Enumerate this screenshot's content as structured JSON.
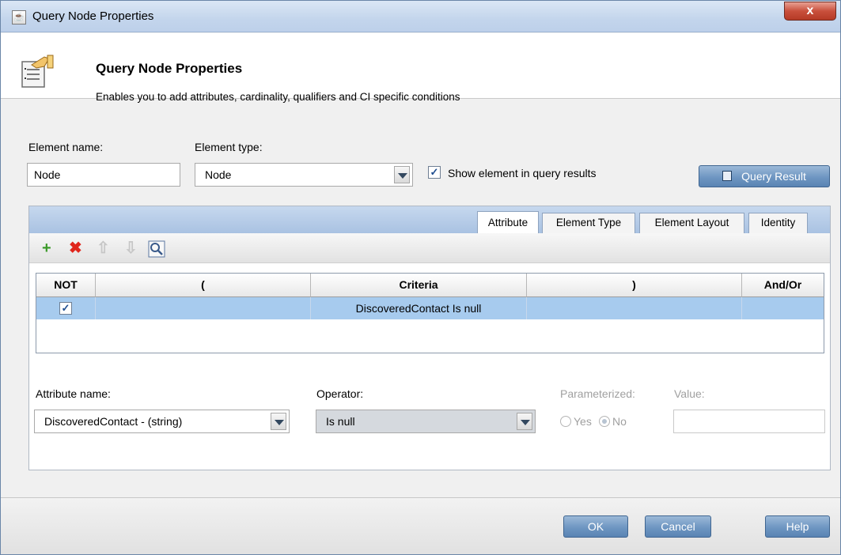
{
  "window": {
    "title": "Query Node Properties",
    "close_label": "x"
  },
  "header": {
    "title": "Query Node Properties",
    "subtitle": "Enables you to add attributes, cardinality, qualifiers and CI specific conditions"
  },
  "element": {
    "name_label": "Element name:",
    "name_value": "Node",
    "type_label": "Element type:",
    "type_value": "Node",
    "show_in_results_label": "Show element in query results",
    "show_in_results_checked": true,
    "query_result_button": "Query Result"
  },
  "tabs": [
    {
      "label": "Attribute",
      "active": true
    },
    {
      "label": "Element Type",
      "active": false
    },
    {
      "label": "Element Layout",
      "active": false
    },
    {
      "label": "Identity",
      "active": false
    }
  ],
  "toolbar": {
    "icons": [
      "add-icon",
      "delete-icon",
      "move-up-icon",
      "move-down-icon",
      "search-icon"
    ]
  },
  "grid": {
    "columns": [
      "NOT",
      "(",
      "Criteria",
      ")",
      "And/Or"
    ],
    "rows": [
      {
        "not": true,
        "open": "",
        "criteria": "DiscoveredContact Is null",
        "close": "",
        "and_or": ""
      }
    ]
  },
  "attribute": {
    "name_label": "Attribute name:",
    "name_value": "DiscoveredContact - (string)",
    "operator_label": "Operator:",
    "operator_value": "Is null",
    "parameterized_label": "Parameterized:",
    "yes_label": "Yes",
    "no_label": "No",
    "value_label": "Value:",
    "value_value": ""
  },
  "footer": {
    "ok": "OK",
    "cancel": "Cancel",
    "help": "Help"
  },
  "colors": {
    "button_blue": "#6e96c2",
    "selected_row": "#a7cbee",
    "close_red": "#c9503c"
  }
}
